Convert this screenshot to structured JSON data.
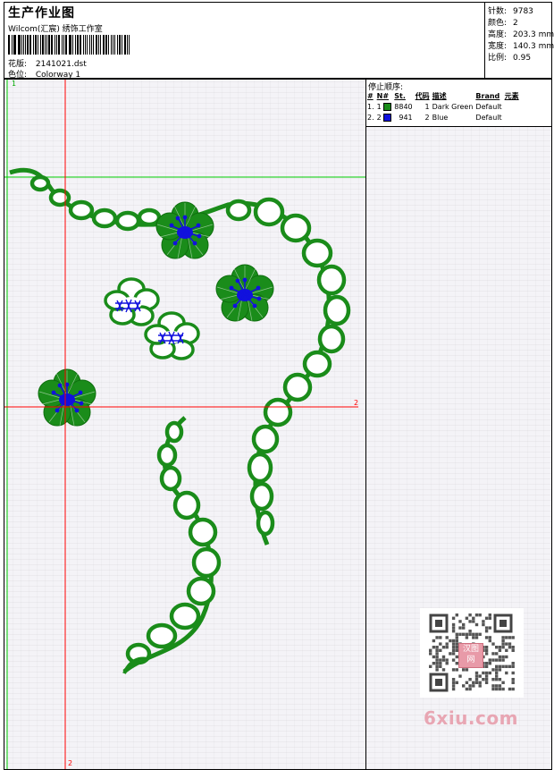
{
  "header": {
    "title": "生产作业图",
    "company": "Wilcom(汇宸) 绣饰工作室",
    "design_label": "花版:",
    "design_value": "2141021.dst",
    "colorway_label": "色位:",
    "colorway_value": "Colorway 1"
  },
  "stats": [
    {
      "label": "针数:",
      "value": "9783"
    },
    {
      "label": "颜色:",
      "value": "2"
    },
    {
      "label": "高度:",
      "value": "203.3 mm"
    },
    {
      "label": "宽度:",
      "value": "140.3 mm"
    },
    {
      "label": "比例:",
      "value": "0.95"
    }
  ],
  "stop_sequence": {
    "title": "停止顺序:",
    "headers": [
      "#",
      "N#",
      "St.",
      "代码",
      "描述",
      "Brand",
      "元素"
    ],
    "rows": [
      {
        "index": "1.",
        "needle": "1",
        "stitches": "8840",
        "code": "1",
        "description": "Dark Green",
        "brand": "Default",
        "color": "#1a8c1a"
      },
      {
        "index": "2.",
        "needle": "2",
        "stitches": "941",
        "code": "2",
        "description": "Blue",
        "brand": "Default",
        "color": "#1111dd"
      }
    ]
  },
  "axes": {
    "origin_label": "1",
    "h_guide_label": "2",
    "v_guide_label": "2"
  },
  "colors": {
    "green": "#1a8c1a",
    "blue": "#1111dd",
    "guide_red": "#ff0000",
    "guide_green": "#00cc00"
  },
  "watermark": {
    "text": "6xiu.com",
    "stamp_text": "汉图网"
  }
}
